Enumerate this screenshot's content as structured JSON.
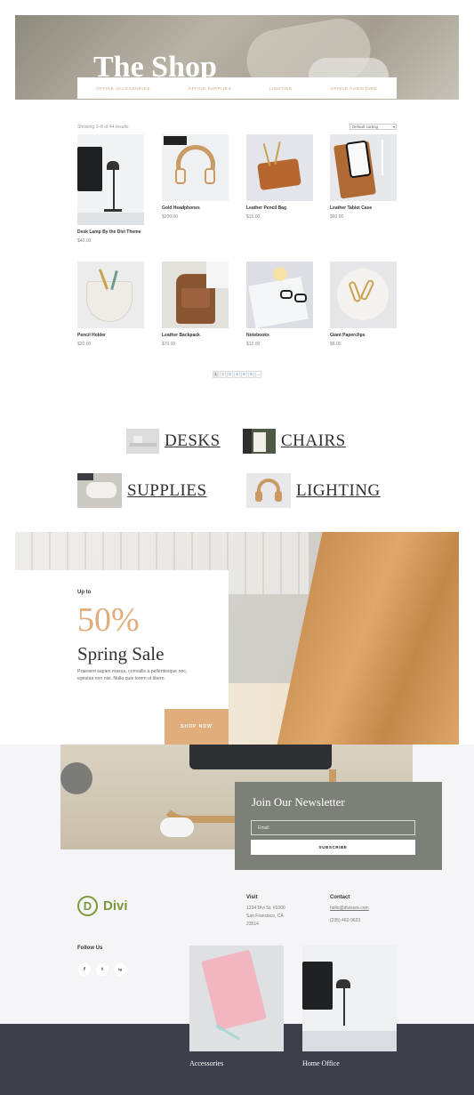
{
  "hero": {
    "title": "The Shop",
    "nav": [
      "Office Accessories",
      "Office Supplies",
      "Lighting",
      "Office Furniture"
    ]
  },
  "shop": {
    "results_text": "Showing 1–8 of 44 results",
    "sort_label": "Default sorting",
    "products": [
      {
        "name": "Desk Lamp By the Divi Theme",
        "price": "$40.00"
      },
      {
        "name": "Gold Headphones",
        "price": "$200.00"
      },
      {
        "name": "Leather Pencil Bag",
        "price": "$15.00"
      },
      {
        "name": "Leather Tablet Case",
        "price": "$60.00"
      },
      {
        "name": "Pencil Holder",
        "price": "$20.00"
      },
      {
        "name": "Leather Backpack",
        "price": "$70.00"
      },
      {
        "name": "Notebooks",
        "price": "$12.00"
      },
      {
        "name": "Giant Paperclips",
        "price": "$8.00"
      }
    ],
    "pagination": [
      "1",
      "2",
      "3",
      "4",
      "5",
      "6",
      "→"
    ]
  },
  "categories": [
    "DESKS",
    "CHAIRS",
    "SUPPLIES",
    "LIGHTING"
  ],
  "promo": {
    "eyebrow": "Up to",
    "percent": "50%",
    "title": "Spring Sale",
    "description": "Praesent sapien massa, convallis a pellentesque nec, egestas non nisi. Nulla quis lorem ut libero.",
    "cta": "SHOP NOW",
    "accent_color": "#e0ad7b"
  },
  "newsletter": {
    "title": "Join Our Newsletter",
    "email_placeholder": "Email",
    "subscribe_label": "SUBSCRIBE"
  },
  "footer": {
    "logo_text": "Divi",
    "logo_mark": "D",
    "visit_heading": "Visit",
    "address": [
      "1234 Divi St. #1000",
      "San Francisco, CA",
      "23514"
    ],
    "contact_heading": "Contact",
    "email": "hello@divisore.com",
    "phone": "(235) 462-9623",
    "follow_heading": "Follow Us",
    "social": [
      "f",
      "t",
      "ig"
    ],
    "cards": [
      "Accessories",
      "Home Office"
    ]
  },
  "colors": {
    "accent": "#e0ad7b",
    "brand_green": "#7d9a3a",
    "newsletter_bg": "#7b8078",
    "footer_dark": "#3d3f4a"
  }
}
